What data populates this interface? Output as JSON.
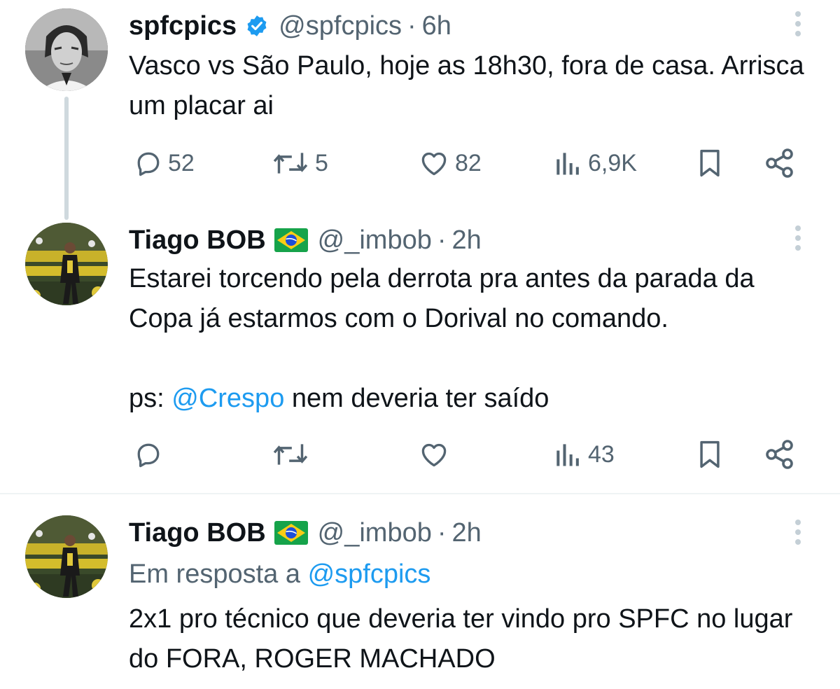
{
  "tweets": [
    {
      "name": "spfcpics",
      "handle": "@spfcpics",
      "separator": "·",
      "time": "6h",
      "verified": true,
      "text": "Vasco vs São Paulo, hoje as 18h30, fora de casa. Arrisca um placar ai",
      "actions": {
        "replies": "52",
        "retweets": "5",
        "likes": "82",
        "views": "6,9K"
      }
    },
    {
      "name": "Tiago BOB",
      "flag": "🇧🇷",
      "handle": "@_imbob",
      "separator": "·",
      "time": "2h",
      "text_line1": "Estarei torcendo pela derrota pra antes da parada da Copa já estarmos com o Dorival no comando.",
      "text_ps_prefix": "ps: ",
      "text_ps_mention": "@Crespo",
      "text_ps_suffix": " nem deveria ter saído",
      "actions": {
        "replies": "",
        "retweets": "",
        "likes": "",
        "views": "43"
      }
    },
    {
      "name": "Tiago BOB",
      "flag": "🇧🇷",
      "handle": "@_imbob",
      "separator": "·",
      "time": "2h",
      "reply_prefix": "Em resposta a ",
      "reply_mention": "@spfcpics",
      "text": "2x1 pro técnico que deveria ter vindo pro SPFC no lugar do FORA, ROGER MACHADO"
    }
  ],
  "icons": {
    "reply": "speech-bubble-icon",
    "retweet": "retweet-arrows-icon",
    "like": "heart-icon",
    "views": "bar-chart-icon",
    "bookmark": "bookmark-icon",
    "share": "share-icon",
    "more": "vertical-dots-icon",
    "verified": "verified-badge-icon"
  },
  "colors": {
    "link": "#1d9bf0",
    "secondary": "#536471",
    "text": "#0f1419",
    "verified": "#1d9bf0"
  }
}
